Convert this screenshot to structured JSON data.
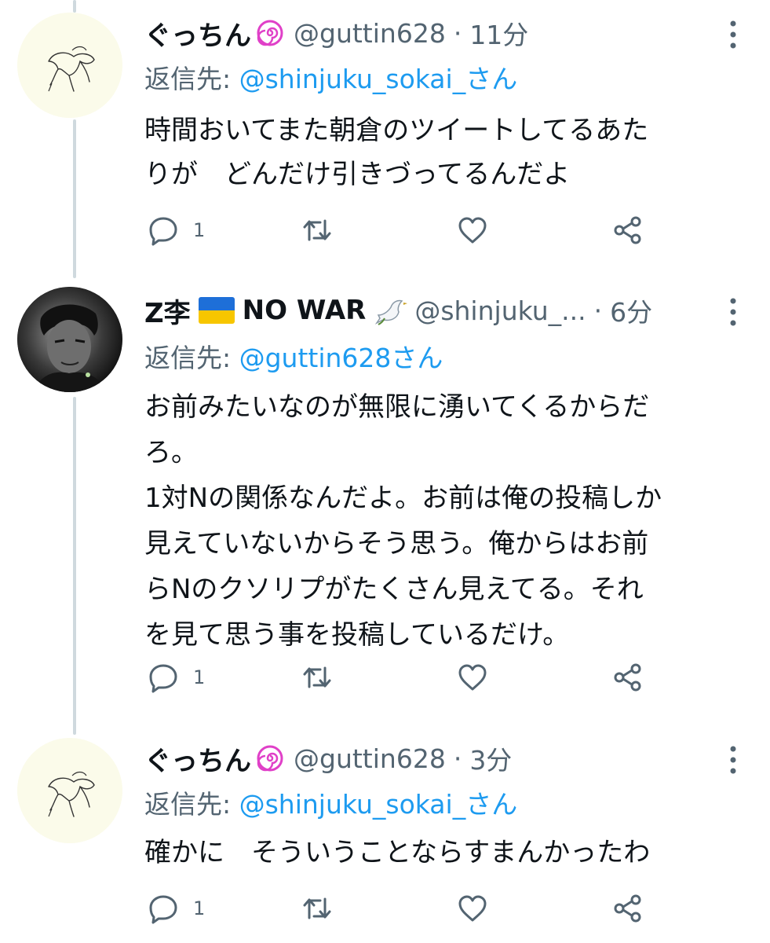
{
  "tweets": [
    {
      "name": "ぐっちん",
      "handle": "@guttin628",
      "dot": "·",
      "time": "11分",
      "reply_label": "返信先: ",
      "reply_mention": "@shinjuku_sokai_さん",
      "lines": [
        "時間おいてまた朝倉のツイートしてるあた",
        "りが　どんだけ引きづってるんだよ"
      ],
      "reply_count": "1"
    },
    {
      "name": "Z李",
      "name_suffix": "NO WAR",
      "handle": "@shinjuku_...",
      "dot": "·",
      "time": "6分",
      "reply_label": "返信先: ",
      "reply_mention": "@guttin628さん",
      "lines": [
        "お前みたいなのが無限に湧いてくるからだ",
        "ろ。",
        "1対Nの関係なんだよ。お前は俺の投稿しか",
        "見えていないからそう思う。俺からはお前",
        "らNのクソリプがたくさん見えてる。それ",
        "を見て思う事を投稿しているだけ。"
      ],
      "reply_count": "1"
    },
    {
      "name": "ぐっちん",
      "handle": "@guttin628",
      "dot": "·",
      "time": "3分",
      "reply_label": "返信先: ",
      "reply_mention": "@shinjuku_sokai_さん",
      "lines": [
        "確かに　そういうことならすまんかったわ"
      ],
      "reply_count": "1"
    }
  ],
  "icons": {
    "reply": "reply-icon",
    "retweet": "retweet-icon",
    "like": "heart-icon",
    "share": "share-icon",
    "more": "more-icon",
    "badge": "naruto-badge-icon",
    "flag": "ukraine-flag-icon",
    "dove": "dove-icon"
  },
  "colors": {
    "text": "#0f1419",
    "secondary": "#536471",
    "link": "#1d9bf0",
    "thread_line": "#cfd9de",
    "badge": "#e040c8"
  }
}
